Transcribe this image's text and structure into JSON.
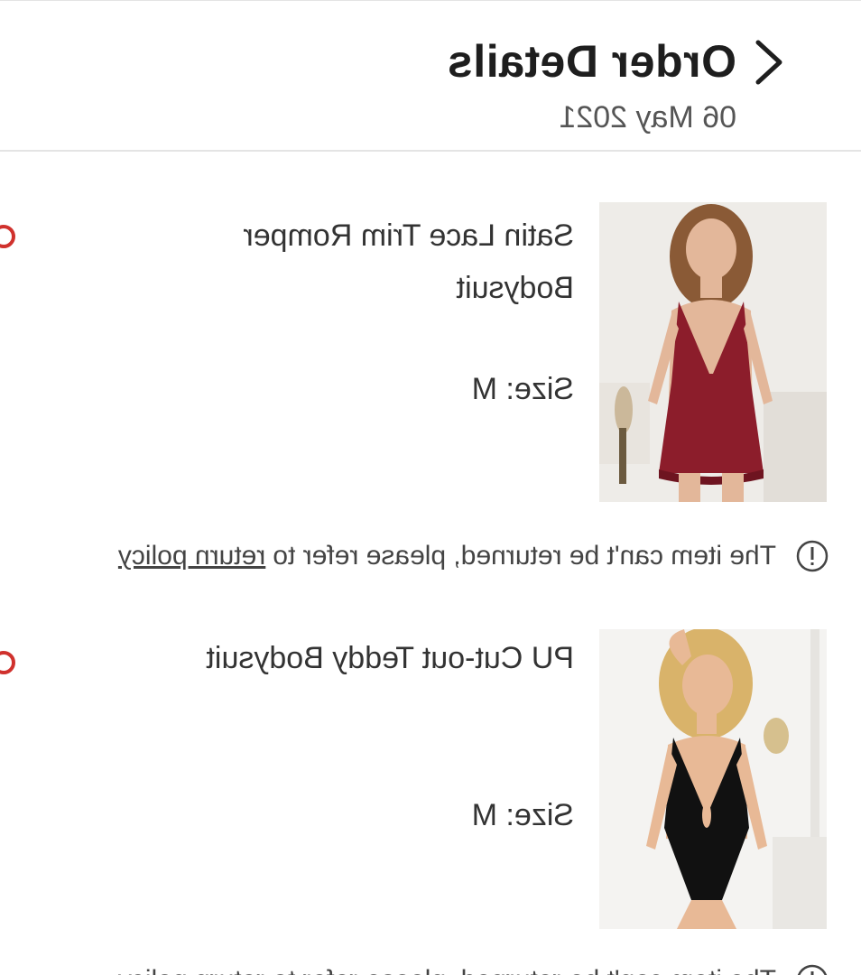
{
  "header": {
    "title": "Order Details",
    "date": "06 May 2021"
  },
  "items": [
    {
      "name": "Satin Lace Trim Romper Bodysuit",
      "size": "Size: M",
      "garment_color": "#8c1d2b",
      "notice_text": "The item can't be returned, please refer to",
      "notice_link": "return policy"
    },
    {
      "name": "PU Cut-out Teddy Bodysuit",
      "size": "Size: M",
      "garment_color": "#111111",
      "notice_text": "The item can't be returned, please refer to",
      "notice_link": "return policy"
    }
  ],
  "colors": {
    "accent": "#d0312d",
    "text": "#333333",
    "divider": "#e4e4e4"
  },
  "icons": [
    "back-chevron-icon",
    "info-circle-icon",
    "status-badge-icon"
  ]
}
